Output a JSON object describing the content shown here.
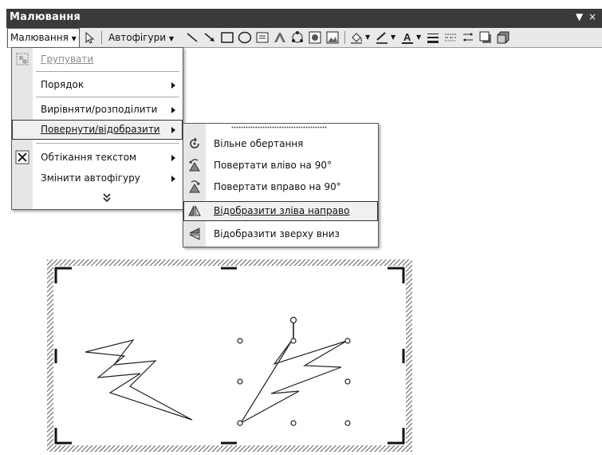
{
  "window": {
    "title": "Малювання",
    "controls": [
      "▼",
      "×"
    ]
  },
  "toolbar": {
    "draw_menu": "Малювання",
    "autoshapes": "Автофігури",
    "icons": [
      "select-arrow-icon",
      "line-icon",
      "arrow-icon",
      "rectangle-icon",
      "oval-icon",
      "textbox-icon",
      "wordart-icon",
      "diagram-icon",
      "clipart-icon",
      "picture-icon",
      "fill-color-icon",
      "line-color-icon",
      "font-color-icon",
      "line-style-icon",
      "dash-style-icon",
      "arrow-style-icon",
      "shadow-icon",
      "3d-icon"
    ]
  },
  "menu": {
    "items": [
      {
        "label": "Групувати",
        "disabled": true,
        "submenu": false
      },
      {
        "label": "Порядок",
        "disabled": false,
        "submenu": true
      },
      {
        "label": "Вирівняти/розподілити",
        "disabled": false,
        "submenu": true
      },
      {
        "label": "Повернути/відобразити",
        "disabled": false,
        "submenu": true,
        "highlighted": true
      },
      {
        "label": "Обтікання текстом",
        "disabled": false,
        "submenu": true
      },
      {
        "label": "Змінити автофігуру",
        "disabled": false,
        "submenu": true
      }
    ],
    "expand_icon": "double-chevron-down-icon"
  },
  "submenu": {
    "items": [
      {
        "label": "Вільне обертання",
        "icon": "free-rotate-icon"
      },
      {
        "label": "Повертати вліво на 90°",
        "icon": "rotate-left-icon"
      },
      {
        "label": "Повертати вправо на 90°",
        "icon": "rotate-right-icon"
      },
      {
        "label": "Відобразити зліва направо",
        "icon": "flip-horizontal-icon",
        "highlighted": true
      },
      {
        "label": "Відобразити зверху вниз",
        "icon": "flip-vertical-icon"
      }
    ]
  },
  "colors": {
    "titlebar": "#3a3a3a",
    "toolbar": "#e9e9e9",
    "menu_gutter": "#e6e6e6",
    "highlight": "#f0f0f0"
  }
}
